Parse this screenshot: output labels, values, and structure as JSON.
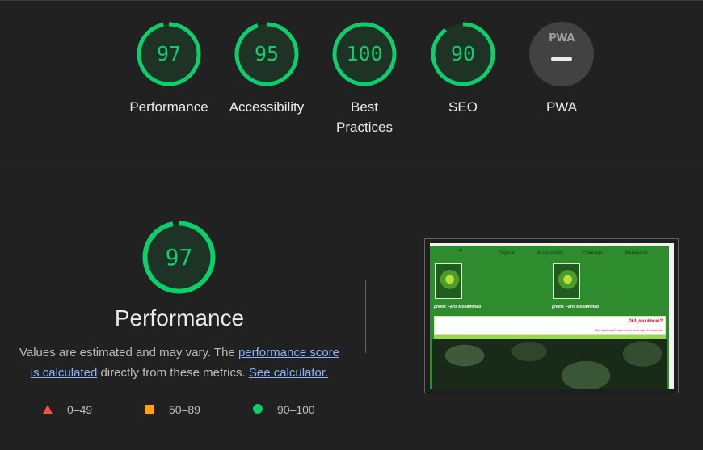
{
  "categories": [
    {
      "score": "97",
      "label": "Performance",
      "fraction": 0.97,
      "color": "#0cce6b"
    },
    {
      "score": "95",
      "label": "Accessibility",
      "fraction": 0.95,
      "color": "#0cce6b"
    },
    {
      "score": "100",
      "label": "Best Practices",
      "fraction": 1.0,
      "color": "#0cce6b"
    },
    {
      "score": "90",
      "label": "SEO",
      "fraction": 0.9,
      "color": "#0cce6b"
    }
  ],
  "pwa": {
    "label": "PWA",
    "badge_text": "PWA"
  },
  "performance": {
    "score": "97",
    "fraction": 0.97,
    "title": "Performance",
    "desc_prefix": "Values are estimated and may vary. The ",
    "link_score": "performance score is calculated",
    "desc_mid": " directly from these metrics. ",
    "link_calc": "See calculator."
  },
  "legend": {
    "fail": "0–49",
    "average": "50–89",
    "pass": "90–100",
    "colors": {
      "fail": "#ff4e42",
      "average": "#ffa400",
      "pass": "#0cce6b"
    }
  },
  "thumbnail": {
    "nav": [
      "Topical",
      "Accessibility",
      "Cabinets",
      "Rainforest"
    ],
    "caption_left": "photo: Faris Mohammed",
    "caption_right": "photo: Faris Mohammed",
    "did_you_know": "Did you know?",
    "did_text": "The rainforest hosts a rich diversity of insect life."
  }
}
